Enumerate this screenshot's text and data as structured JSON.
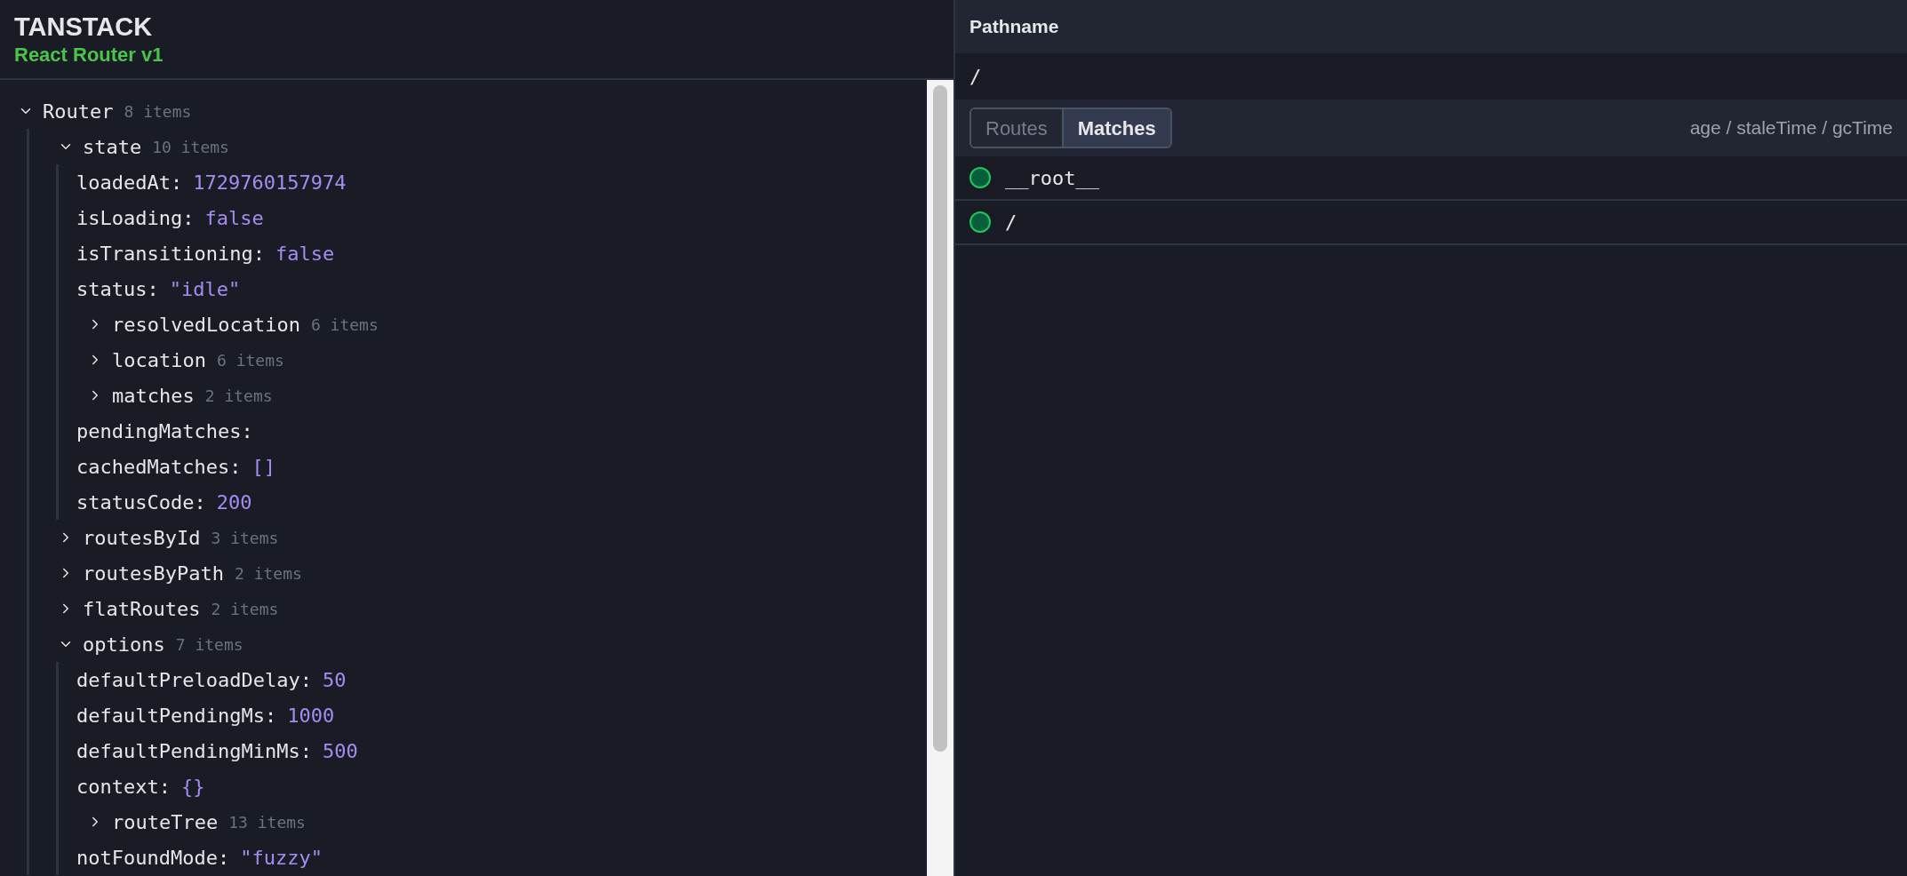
{
  "header": {
    "brand": "TANSTACK",
    "subtitle": "React Router v1"
  },
  "tree": {
    "key": "Router",
    "count": "8 items",
    "expanded": true,
    "children": [
      {
        "key": "state",
        "count": "10 items",
        "expanded": true,
        "children": [
          {
            "key": "loadedAt:",
            "value": "1729760157974"
          },
          {
            "key": "isLoading:",
            "value": "false"
          },
          {
            "key": "isTransitioning:",
            "value": "false"
          },
          {
            "key": "status:",
            "value": "\"idle\""
          },
          {
            "key": "resolvedLocation",
            "count": "6 items",
            "expanded": false
          },
          {
            "key": "location",
            "count": "6 items",
            "expanded": false
          },
          {
            "key": "matches",
            "count": "2 items",
            "expanded": false
          },
          {
            "key": "pendingMatches:"
          },
          {
            "key": "cachedMatches:",
            "value": "[]"
          },
          {
            "key": "statusCode:",
            "value": "200"
          }
        ]
      },
      {
        "key": "routesById",
        "count": "3 items",
        "expanded": false
      },
      {
        "key": "routesByPath",
        "count": "2 items",
        "expanded": false
      },
      {
        "key": "flatRoutes",
        "count": "2 items",
        "expanded": false
      },
      {
        "key": "options",
        "count": "7 items",
        "expanded": true,
        "children": [
          {
            "key": "defaultPreloadDelay:",
            "value": "50"
          },
          {
            "key": "defaultPendingMs:",
            "value": "1000"
          },
          {
            "key": "defaultPendingMinMs:",
            "value": "500"
          },
          {
            "key": "context:",
            "value": "{}"
          },
          {
            "key": "routeTree",
            "count": "13 items",
            "expanded": false
          },
          {
            "key": "notFoundMode:",
            "value": "\"fuzzy\""
          }
        ]
      }
    ]
  },
  "pathname": {
    "label": "Pathname",
    "value": "/"
  },
  "tabs": [
    {
      "label": "Routes",
      "selected": false
    },
    {
      "label": "Matches",
      "selected": true
    }
  ],
  "timing_label": "age / staleTime / gcTime",
  "matches": [
    {
      "id": "__root__",
      "color": "#065f3a"
    },
    {
      "id": "/",
      "color": "#065f3a"
    }
  ]
}
